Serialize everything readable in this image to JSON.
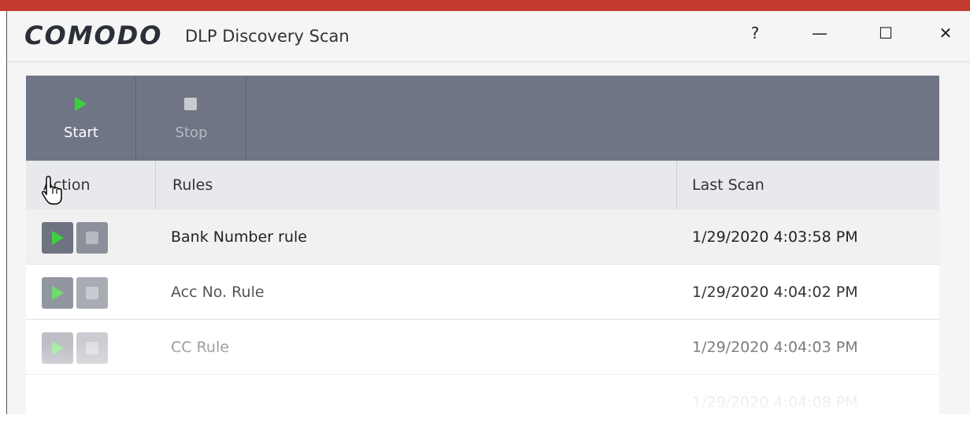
{
  "window": {
    "brand": "COMODO",
    "title": "DLP Discovery Scan",
    "controls": {
      "help": "?",
      "minimize": "—",
      "maximize": "☐",
      "close": "✕"
    }
  },
  "toolbar": {
    "start_label": "Start",
    "stop_label": "Stop"
  },
  "table": {
    "columns": [
      "Action",
      "Rules",
      "Last Scan"
    ],
    "rows": [
      {
        "rule": "Bank Number rule",
        "last_scan": "1/29/2020 4:03:58 PM"
      },
      {
        "rule": "Acc No. Rule",
        "last_scan": "1/29/2020 4:04:02 PM"
      },
      {
        "rule": "CC Rule",
        "last_scan": "1/29/2020 4:04:03 PM"
      },
      {
        "rule": "",
        "last_scan": "1/29/2020 4:04:08 PM"
      }
    ]
  },
  "colors": {
    "accent_red": "#c53a2e",
    "toolbar": "#6f7585",
    "play_green": "#3bd33b"
  }
}
